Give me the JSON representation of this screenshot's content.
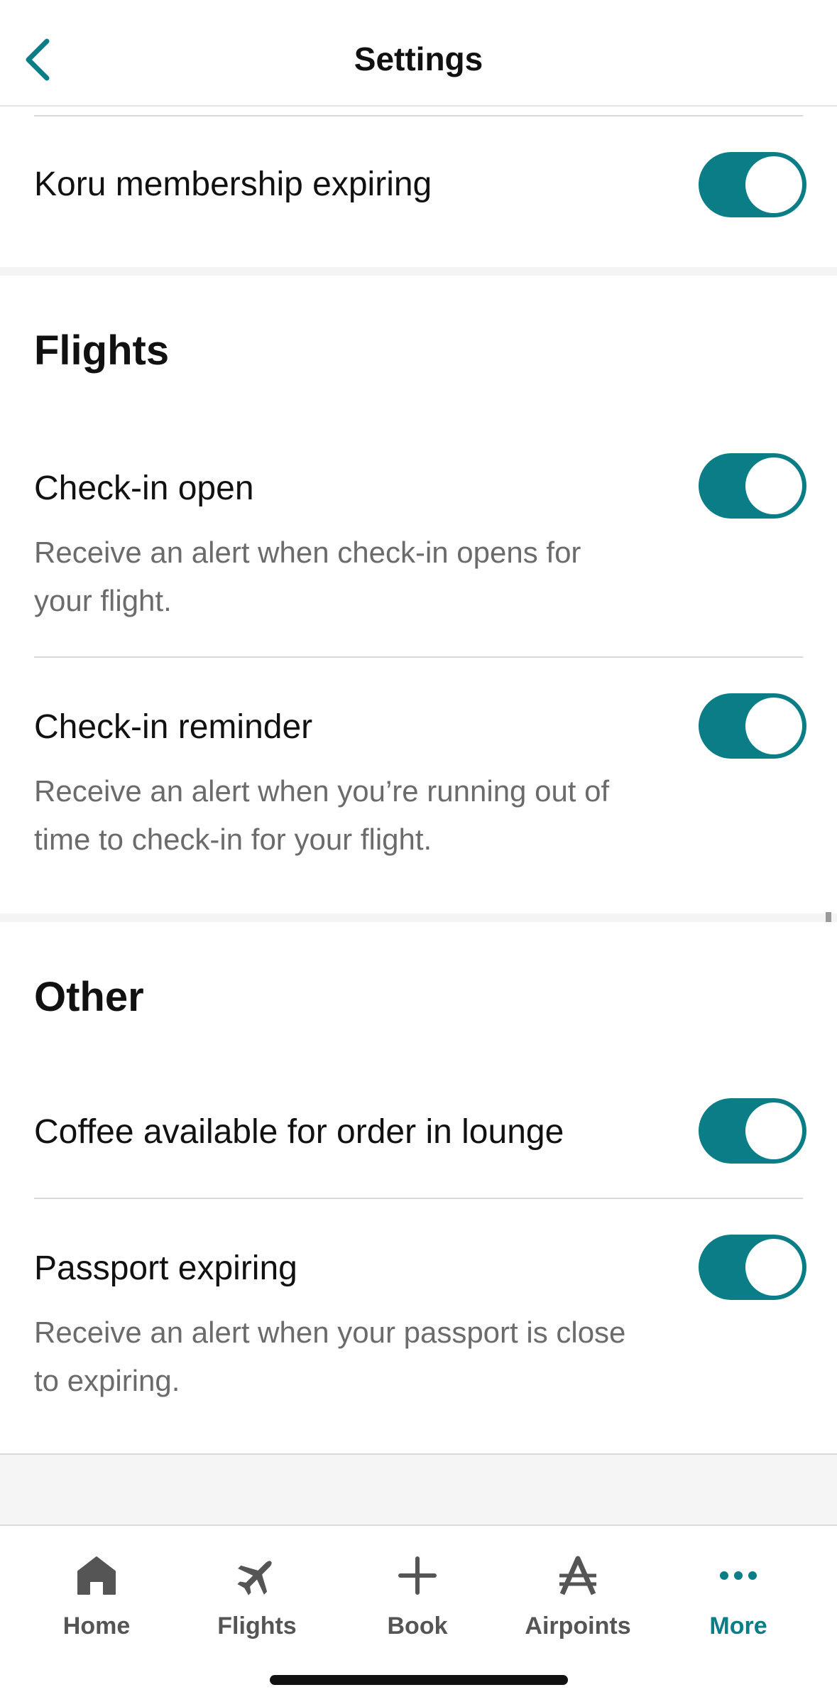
{
  "header": {
    "title": "Settings"
  },
  "koru": {
    "label": "Koru membership expiring",
    "enabled": true
  },
  "flights": {
    "title": "Flights",
    "items": [
      {
        "label": "Check-in open",
        "description_line1": "Receive an alert when check-in opens for",
        "description_line2": "your flight.",
        "enabled": true
      },
      {
        "label": "Check-in reminder",
        "description_line1": "Receive an alert when you’re running out of",
        "description_line2": "time to check-in for your flight.",
        "enabled": true
      }
    ]
  },
  "other": {
    "title": "Other",
    "items": [
      {
        "label": "Coffee available for order in lounge",
        "enabled": true
      },
      {
        "label": "Passport expiring",
        "description_line1": "Receive an alert when your passport is close",
        "description_line2": "to expiring.",
        "enabled": true
      }
    ]
  },
  "tabbar": {
    "items": [
      {
        "label": "Home",
        "icon": "home-icon",
        "active": false
      },
      {
        "label": "Flights",
        "icon": "plane-icon",
        "active": false
      },
      {
        "label": "Book",
        "icon": "plus-icon",
        "active": false
      },
      {
        "label": "Airpoints",
        "icon": "airpoints-icon",
        "active": false
      },
      {
        "label": "More",
        "icon": "more-dots-icon",
        "active": true
      }
    ]
  },
  "colors": {
    "accent": "#0a7d86",
    "text": "#111111",
    "muted": "#6b6b6b",
    "inactive_tab": "#555555"
  }
}
